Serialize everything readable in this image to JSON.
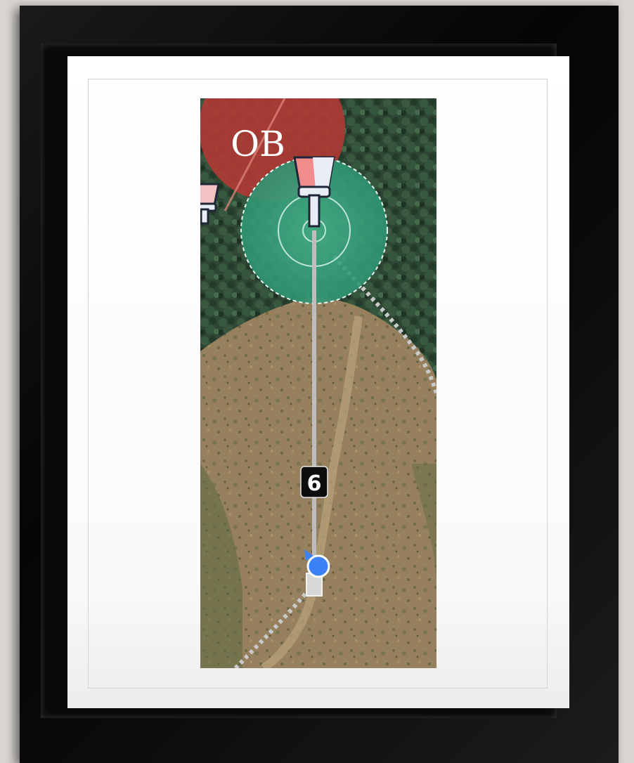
{
  "map": {
    "ob_label": "OB",
    "hole_number": "6",
    "colors": {
      "ob_zone": "#b03a34",
      "target_zone": "#3fa27f",
      "fairway": "#9a8460",
      "trees": "#2f4a35",
      "player_marker": "#3b82f6",
      "label_bg": "#0d0d0d"
    },
    "icons": [
      "disc-golf-basket-icon",
      "disc-golf-basket-icon",
      "player-location-icon",
      "tee-pad-icon",
      "heading-arrow-icon"
    ]
  }
}
